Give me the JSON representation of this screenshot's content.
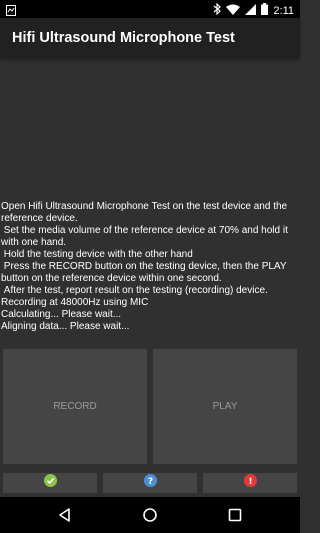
{
  "status_bar": {
    "time": "2:11",
    "icons": [
      "notification-icon",
      "bluetooth-icon",
      "wifi-icon",
      "cell-signal-icon",
      "battery-icon"
    ]
  },
  "app_bar": {
    "title": "Hifi Ultrasound Microphone Test"
  },
  "instructions": [
    "Open Hifi Ultrasound Microphone Test on the test device and the reference device.",
    " Set the media volume of the reference device at 70% and hold it with one hand.",
    " Hold the testing device with the other hand",
    " Press the RECORD button on the testing device, then the PLAY button on the reference device within one second.",
    " After the test, report result on the testing (recording) device.",
    "Recording at 48000Hz using MIC",
    "Calculating... Please wait...",
    "Aligning data... Please wait..."
  ],
  "buttons": {
    "record": "RECORD",
    "play": "PLAY"
  },
  "result_buttons": [
    {
      "name": "pass",
      "icon": "check-icon",
      "color": "#8bc34a"
    },
    {
      "name": "info",
      "icon": "question-icon",
      "color": "#4a90d9"
    },
    {
      "name": "fail",
      "icon": "exclamation-icon",
      "color": "#e53935"
    }
  ],
  "colors": {
    "background": "#303030",
    "app_bar": "#212121",
    "button": "#454545",
    "button_text": "#9a9a9a"
  }
}
